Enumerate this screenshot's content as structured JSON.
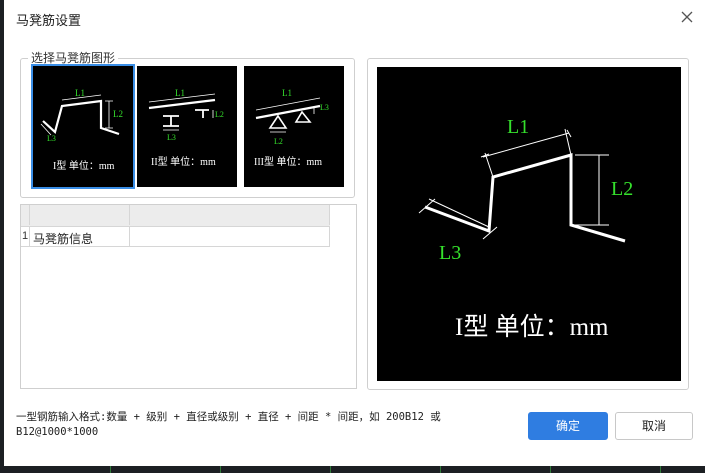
{
  "dialog": {
    "title": "马凳筋设置"
  },
  "group": {
    "label": "选择马凳筋图形"
  },
  "thumbnails": [
    {
      "caption": "I型 单位：mm",
      "l1": "L1",
      "l2": "L2",
      "l3": "L3",
      "selected": true
    },
    {
      "caption": "II型 单位：mm",
      "l1": "L1",
      "l2": "L2",
      "l3": "L3",
      "selected": false
    },
    {
      "caption": "III型 单位：mm",
      "l1": "L1",
      "l2": "L2",
      "l3": "L3",
      "selected": false
    }
  ],
  "grid": {
    "rows": [
      {
        "num": "1",
        "name": "马凳筋信息",
        "value": ""
      }
    ]
  },
  "preview": {
    "l1": "L1",
    "l2": "L2",
    "l3": "L3",
    "caption": "I型 单位：mm"
  },
  "hint": "一型钢筋输入格式:数量 + 级别 + 直径或级别 + 直径 + 间距 * 间距，如 200B12 或 B12@1000*1000",
  "buttons": {
    "ok": "确定",
    "cancel": "取消"
  },
  "colors": {
    "accent": "#2f7de1",
    "dimension_label": "#35e02c",
    "thumbnail_bg": "#000000"
  },
  "icons": {
    "close": "close-icon"
  }
}
